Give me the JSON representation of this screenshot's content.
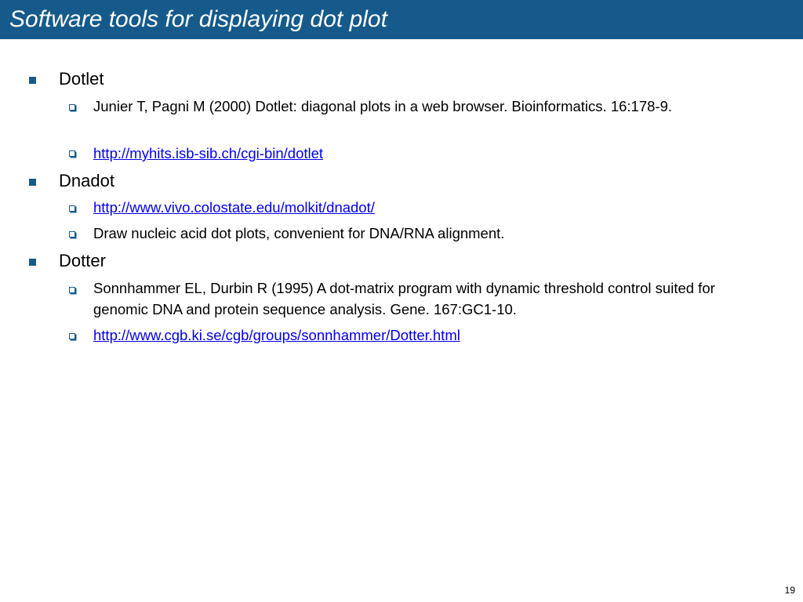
{
  "slide": {
    "title": "Software tools for displaying dot plot",
    "page_number": "19",
    "accent_color": "#155a8a",
    "link_color": "#0000ee",
    "level1_bullet_icon": "filled-square",
    "level2_bullet_icon": "shadowed-box",
    "items": [
      {
        "label": "Dotlet",
        "subitems": [
          {
            "text": "Junier T, Pagni M (2000) Dotlet: diagonal plots in a web browser. Bioinformatics. 16:178-9.",
            "is_link": false
          },
          {
            "text": "http://myhits.isb-sib.ch/cgi-bin/dotlet",
            "is_link": true
          }
        ]
      },
      {
        "label": "Dnadot",
        "subitems": [
          {
            "text": "http://www.vivo.colostate.edu/molkit/dnadot/",
            "is_link": true
          },
          {
            "text": "Draw nucleic acid dot plots, convenient for DNA/RNA alignment.",
            "is_link": false
          }
        ]
      },
      {
        "label": "Dotter",
        "subitems": [
          {
            "text": "Sonnhammer EL, Durbin R (1995) A dot-matrix program with dynamic threshold control suited for genomic DNA and protein sequence analysis. Gene. 167:GC1-10.",
            "is_link": false
          },
          {
            "text": "http://www.cgb.ki.se/cgb/groups/sonnhammer/Dotter.html",
            "is_link": true
          }
        ]
      }
    ]
  }
}
